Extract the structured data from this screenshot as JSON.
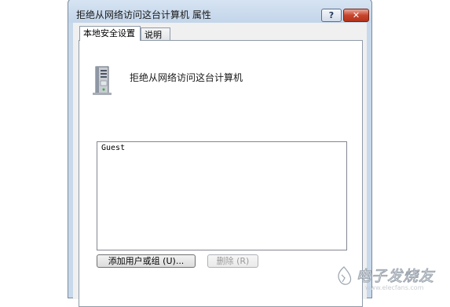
{
  "window": {
    "title": "拒绝从网络访问这台计算机 属性",
    "help_label": "?",
    "close_label": "✕"
  },
  "tabs": [
    {
      "label": "本地安全设置",
      "active": true
    },
    {
      "label": "说明",
      "active": false
    }
  ],
  "policy": {
    "icon": "server-icon",
    "name": "拒绝从网络访问这台计算机"
  },
  "members": {
    "items": [
      "Guest"
    ]
  },
  "buttons": {
    "add_label": "添加用户或组 (U)...",
    "remove_label": "删除 (R)"
  },
  "watermark": {
    "text": "电子发烧友",
    "url": "www.elecfans.com"
  },
  "colors": {
    "title_gradient_top": "#d7e4f2",
    "close_button": "#c8452e",
    "panel_border": "#8f9aa8"
  }
}
